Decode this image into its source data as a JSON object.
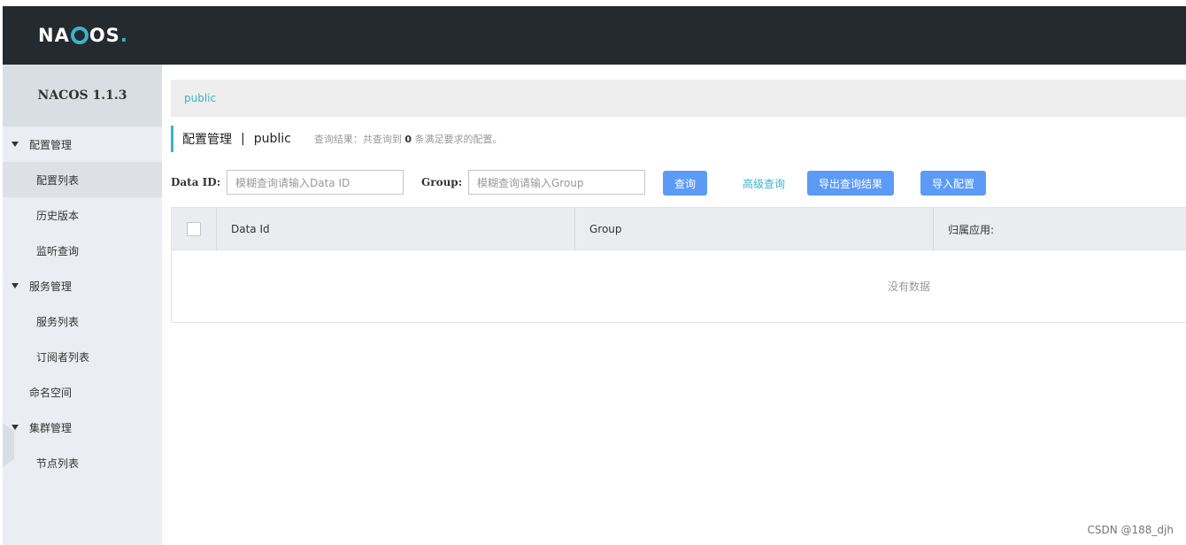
{
  "header": {
    "logo_left": "NA",
    "logo_right": "OS",
    "logo_dot": "."
  },
  "sidebar": {
    "version": "NACOS 1.1.3",
    "items": [
      {
        "label": "配置管理"
      },
      {
        "label": "配置列表"
      },
      {
        "label": "历史版本"
      },
      {
        "label": "监听查询"
      },
      {
        "label": "服务管理"
      },
      {
        "label": "服务列表"
      },
      {
        "label": "订阅者列表"
      },
      {
        "label": "命名空间"
      },
      {
        "label": "集群管理"
      },
      {
        "label": "节点列表"
      }
    ]
  },
  "breadcrumb": {
    "namespace": "public"
  },
  "title": {
    "main": "配置管理",
    "sep": "|",
    "namespace": "public",
    "info_prefix": "查询结果：共查询到",
    "count": "0",
    "info_suffix": "条满足要求的配置。"
  },
  "search": {
    "dataid_label": "Data ID:",
    "dataid_placeholder": "模糊查询请输入Data ID",
    "group_label": "Group:",
    "group_placeholder": "模糊查询请输入Group",
    "query_btn": "查询",
    "advanced": "高级查询",
    "export_btn": "导出查询结果",
    "import_btn": "导入配置"
  },
  "table": {
    "columns": [
      "Data Id",
      "Group",
      "归属应用:"
    ],
    "empty": "没有数据"
  },
  "watermark": "CSDN @188_djh"
}
